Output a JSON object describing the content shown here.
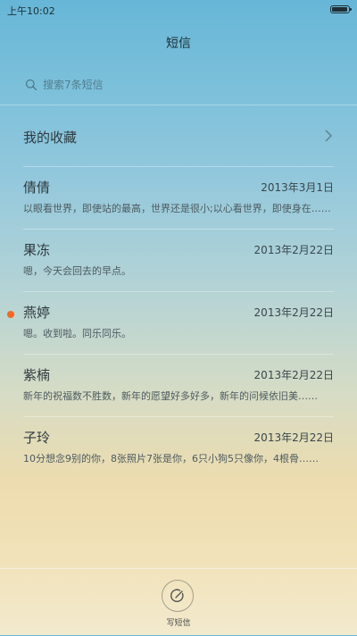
{
  "status_bar": {
    "time": "上午10:02",
    "battery_level": 0.95
  },
  "header": {
    "title": "短信"
  },
  "search": {
    "placeholder": "搜索7条短信"
  },
  "favorites": {
    "label": "我的收藏"
  },
  "messages": [
    {
      "name": "倩倩",
      "date": "2013年3月1日",
      "preview": "以眼看世界，即使站的最高，世界还是很小;以心看世界，即使身在……",
      "unread": false
    },
    {
      "name": "果冻",
      "date": "2013年2月22日",
      "preview": "嗯，今天会回去的早点。",
      "unread": false
    },
    {
      "name": "燕婷",
      "date": "2013年2月22日",
      "preview": "嗯。收到啦。同乐同乐。",
      "unread": true
    },
    {
      "name": "紫楠",
      "date": "2013年2月22日",
      "preview": "新年的祝福数不胜数，新年的愿望好多好多，新年的问候依旧美……",
      "unread": false
    },
    {
      "name": "子玲",
      "date": "2013年2月22日",
      "preview": "10分想念9别的你，8张照片7张是你，6只小狗5只像你，4根骨……",
      "unread": false
    }
  ],
  "bottom": {
    "compose_label": "写短信"
  },
  "colors": {
    "unread_dot": "#f06a24"
  }
}
